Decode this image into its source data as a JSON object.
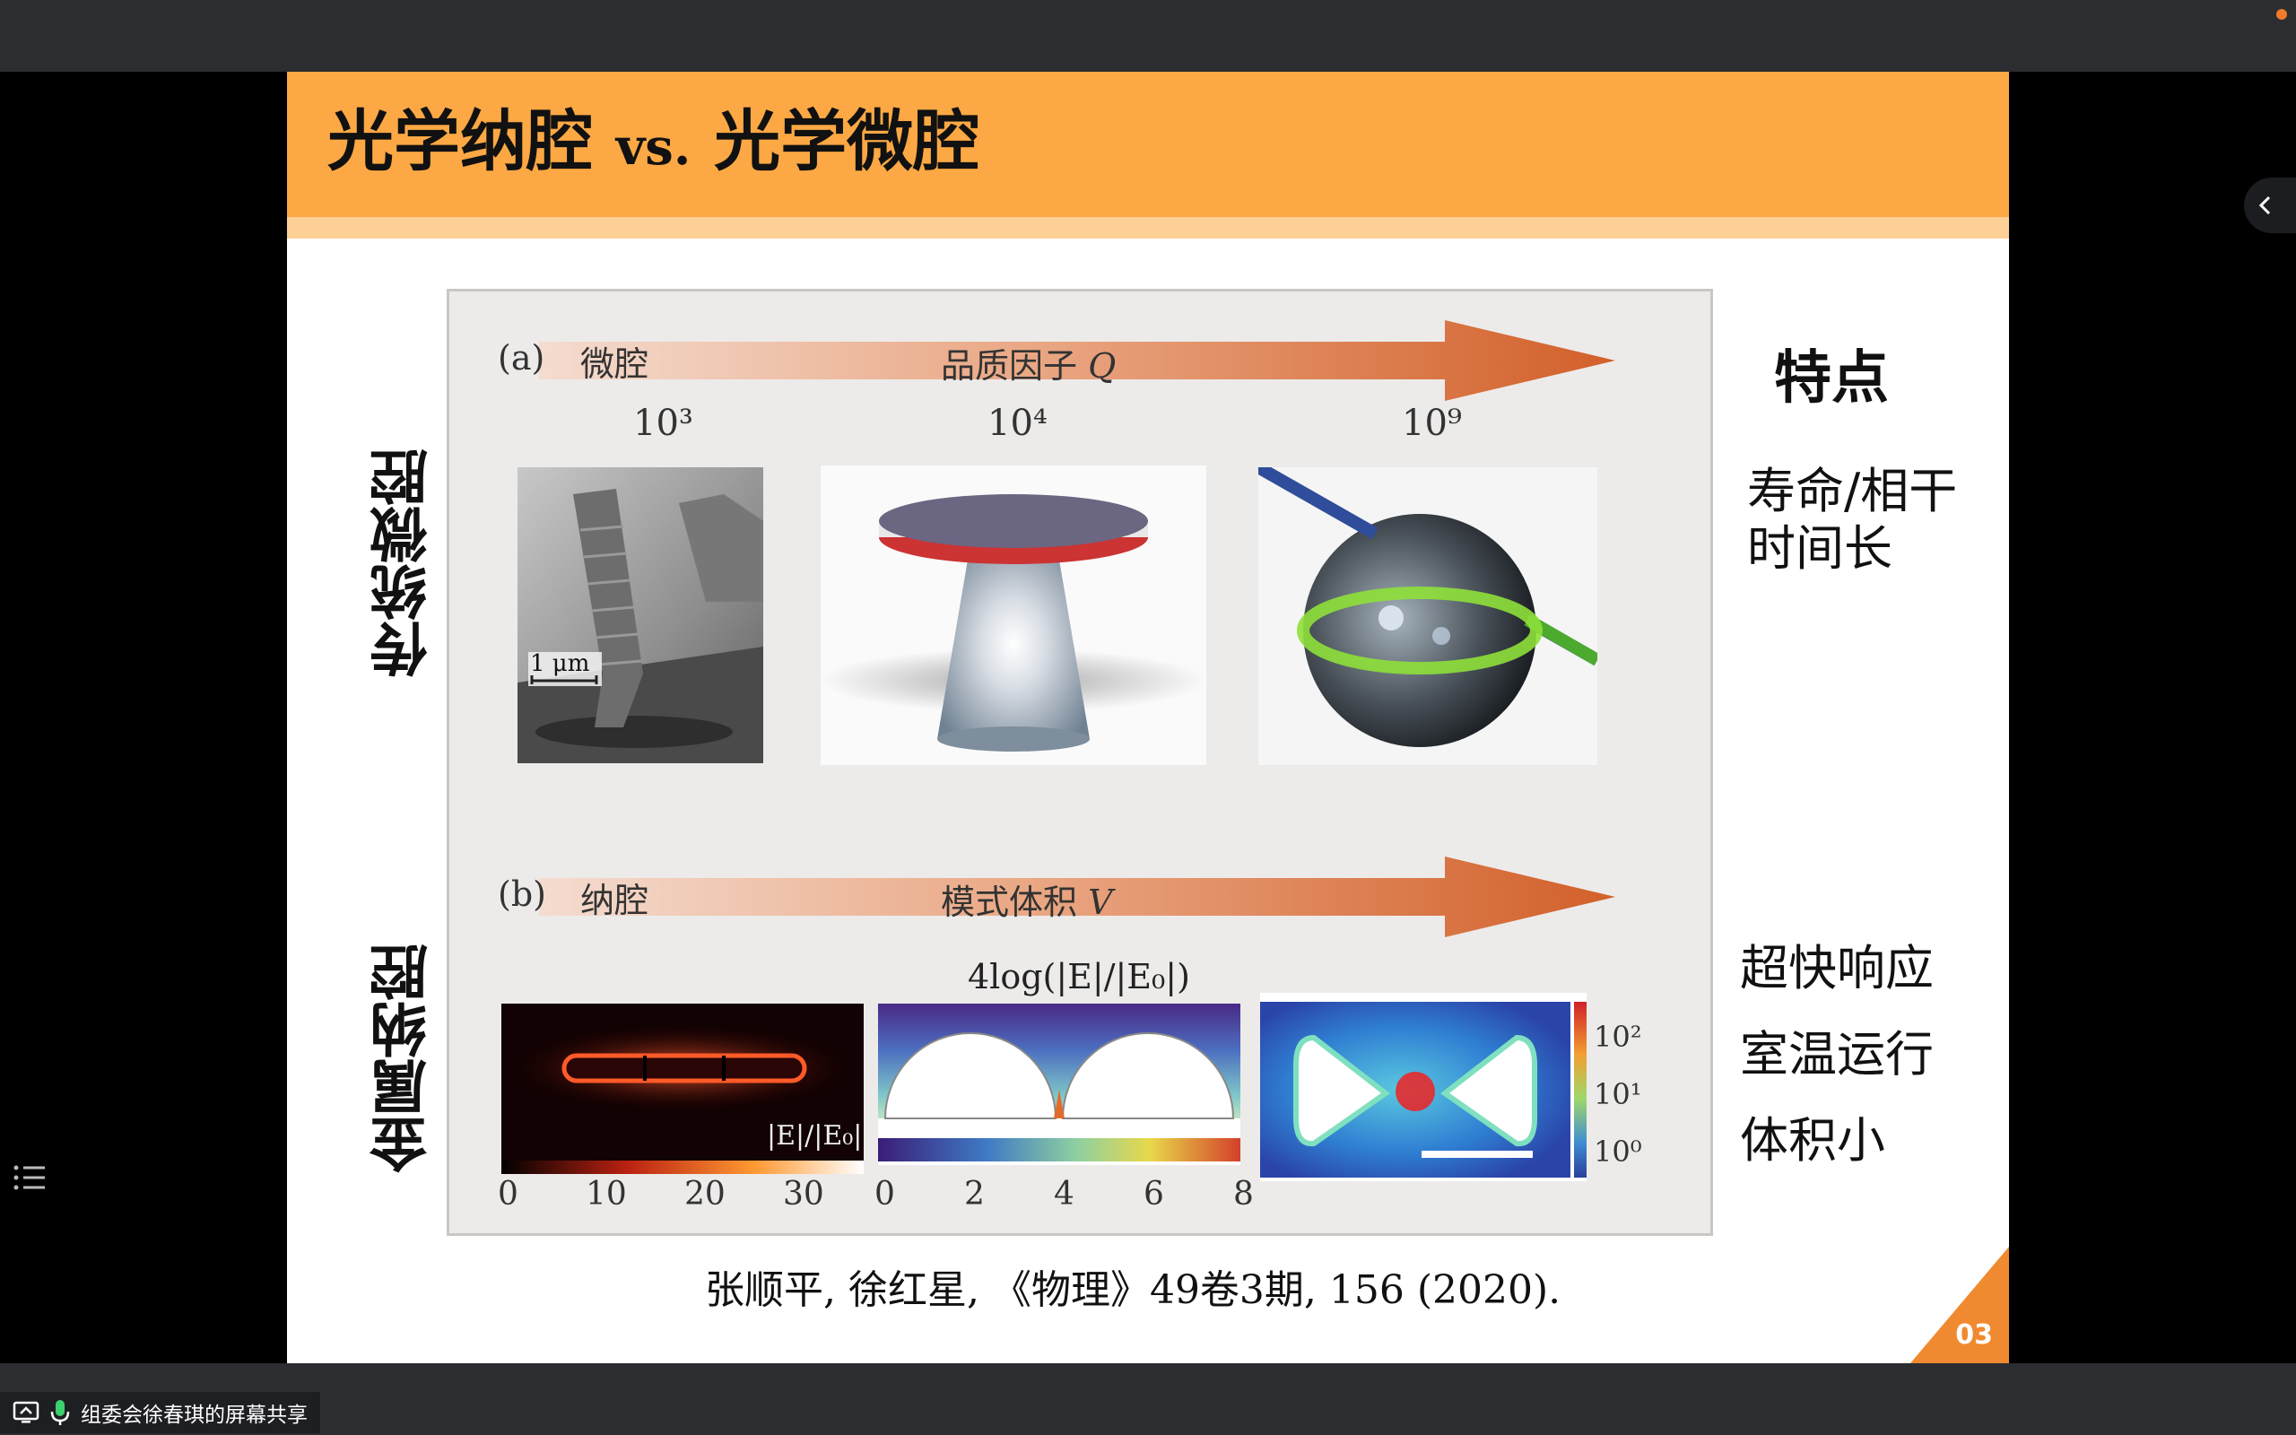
{
  "share": {
    "label": "组委会徐春琪的屏幕共享"
  },
  "slide": {
    "title_left": "光学纳腔",
    "title_vs": "vs.",
    "title_right": "光学微腔",
    "page_number": "03",
    "citation": "张顺平, 徐红星, 《物理》49卷3期, 156 (2020)."
  },
  "figure": {
    "a_label": "(a)",
    "a_name": "微腔",
    "a_arrow_text": "品质因子",
    "a_symbol": "Q",
    "q_values": [
      "10³",
      "10⁴",
      "10⁹"
    ],
    "scale_bar": "1 μm",
    "b_label": "(b)",
    "b_name": "纳腔",
    "b_arrow_text": "模式体积",
    "b_symbol": "V",
    "panel1_label": "|E|/|E₀|",
    "panel1_ticks": [
      "0",
      "10",
      "20",
      "30"
    ],
    "panel2_label": "4log(|E|/|E₀|)",
    "panel2_ticks": [
      "0",
      "2",
      "4",
      "6",
      "8"
    ],
    "panel3_ticks": [
      "10²",
      "10¹",
      "10⁰"
    ]
  },
  "rows": {
    "row1_label": "传统微腔",
    "row2_label": "金属纳腔"
  },
  "features": {
    "title": "特点",
    "row1_line1": "寿命/相干",
    "row1_line2": "时间长",
    "row2_item1": "超快响应",
    "row2_item2": "室温运行",
    "row2_item3": "体积小"
  },
  "colors": {
    "header": "#fca844",
    "header_strip": "#fdd097",
    "arrow": "#d9692e",
    "corner": "#f08a30"
  }
}
